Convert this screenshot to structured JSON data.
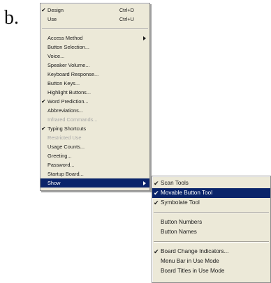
{
  "figure_label": "b.",
  "main_menu": {
    "group1": [
      {
        "label": "Design",
        "shortcut": "Ctrl+D",
        "checked": true
      },
      {
        "label": "Use",
        "shortcut": "Ctrl+U",
        "checked": false
      }
    ],
    "group2": [
      {
        "label": "Access Method",
        "has_submenu": true
      },
      {
        "label": "Button Selection..."
      },
      {
        "label": "Voice..."
      },
      {
        "label": "Speaker Volume..."
      },
      {
        "label": "Keyboard Response..."
      },
      {
        "label": "Button Keys..."
      },
      {
        "label": "Highlight Buttons..."
      },
      {
        "label": "Word Prediction...",
        "checked": true
      },
      {
        "label": "Abbreviations..."
      },
      {
        "label": "Infrared Commands...",
        "disabled": true
      },
      {
        "label": "Typing Shortcuts",
        "checked": true
      },
      {
        "label": "Restricted Use",
        "disabled": true
      },
      {
        "label": "Usage Counts..."
      },
      {
        "label": "Greeting..."
      },
      {
        "label": "Password..."
      },
      {
        "label": "Startup Board..."
      },
      {
        "label": "Show",
        "has_submenu": true,
        "selected": true
      }
    ]
  },
  "sub_menu": {
    "group1": [
      {
        "label": "Scan Tools",
        "checked": true
      },
      {
        "label": "Movable Button Tool",
        "checked": true,
        "selected": true
      },
      {
        "label": "Symbolate Tool",
        "checked": true
      }
    ],
    "group2": [
      {
        "label": "Button Numbers"
      },
      {
        "label": "Button Names"
      }
    ],
    "group3": [
      {
        "label": "Board Change Indicators...",
        "checked": true
      },
      {
        "label": "Menu Bar in Use Mode"
      },
      {
        "label": "Board Titles in Use Mode"
      }
    ]
  },
  "check_glyph": "✔"
}
